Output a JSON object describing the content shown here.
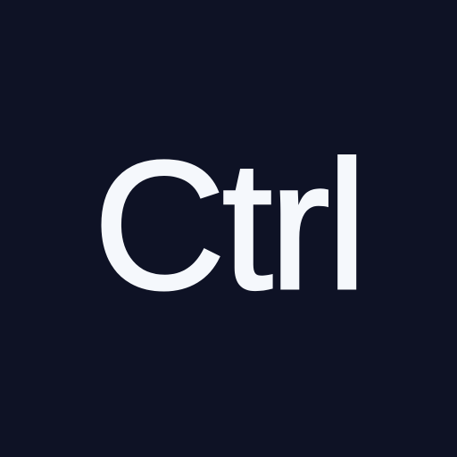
{
  "key": {
    "label": "Ctrl"
  },
  "colors": {
    "background": "#0e1225",
    "text": "#f5f8fc"
  }
}
